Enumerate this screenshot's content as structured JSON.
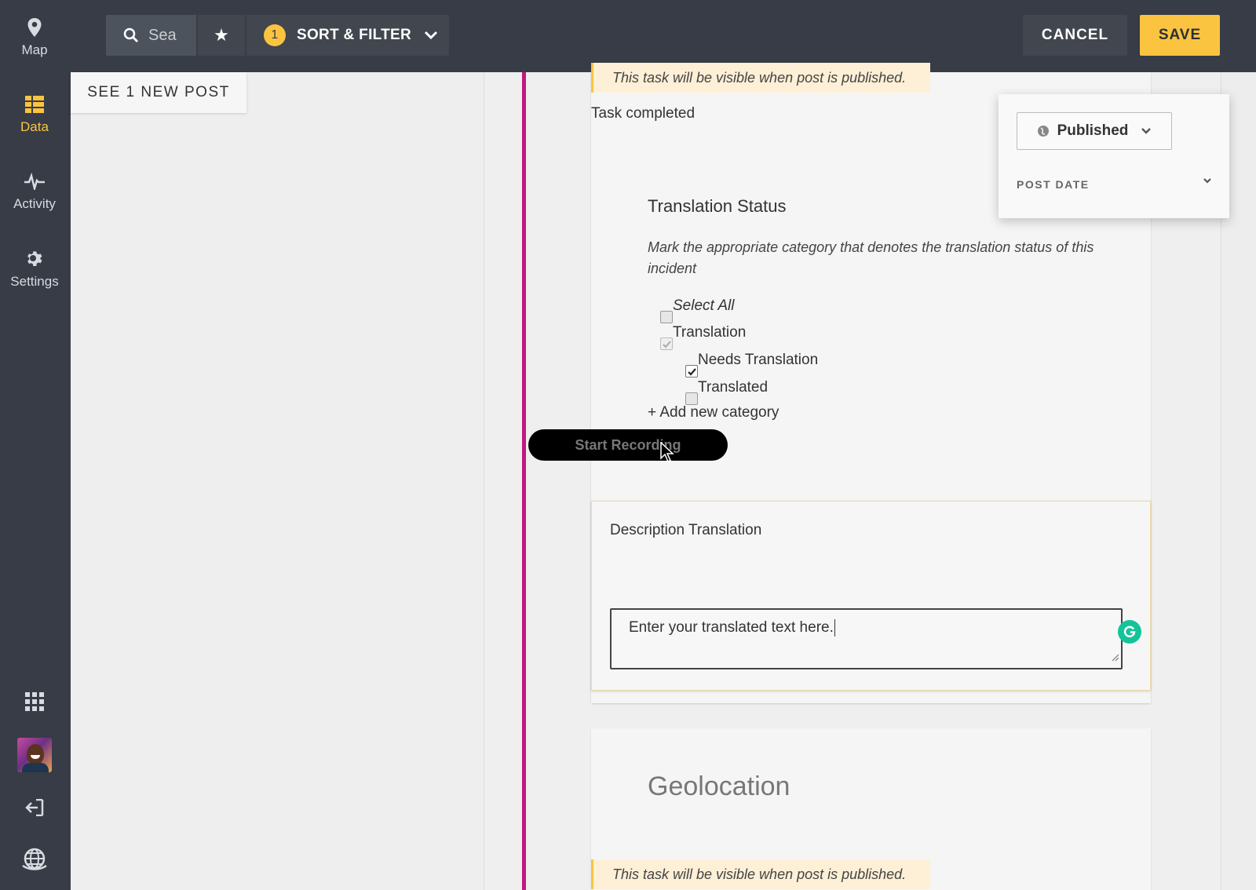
{
  "sidebar": {
    "items": [
      {
        "label": "Map",
        "icon": "map-pin-icon"
      },
      {
        "label": "Data",
        "icon": "data-list-icon",
        "active": true
      },
      {
        "label": "Activity",
        "icon": "activity-pulse-icon"
      },
      {
        "label": "Settings",
        "icon": "gear-icon"
      }
    ],
    "bottom_icons": [
      "apps-grid-icon",
      "avatar",
      "logout-icon",
      "globe-icon"
    ]
  },
  "topbar": {
    "search_placeholder": "Sea",
    "star_glyph": "★",
    "filter_count": "1",
    "sort_filter_label": "SORT & FILTER",
    "cancel_label": "CANCEL",
    "save_label": "SAVE"
  },
  "new_posts_label": "SEE 1 NEW POST",
  "notice_text": "This task will be visible when post is published.",
  "task_completed": "Task completed",
  "translation_status": {
    "title": "Translation Status",
    "description": "Mark the appropriate category that denotes the translation status of this incident",
    "options": [
      {
        "label": "Select All",
        "checked": false,
        "italic": true
      },
      {
        "label": "Translation",
        "checked": true,
        "partial": true
      },
      {
        "label": "Needs Translation",
        "checked": true
      },
      {
        "label": "Translated",
        "checked": false
      }
    ],
    "add_category": "+ Add new category"
  },
  "recording_button": "Start Recording",
  "description_translation": {
    "title": "Description Translation",
    "value": "Enter your translated text here."
  },
  "geolocation": {
    "title": "Geolocation",
    "notice": "This task will be visible when post is published."
  },
  "status_panel": {
    "status": "Published",
    "post_date_label": "POST DATE"
  },
  "colors": {
    "sidebar_bg": "#373c46",
    "accent": "#fbc440",
    "magenta_bar": "#c0197e",
    "grammarly": "#15c39a"
  }
}
